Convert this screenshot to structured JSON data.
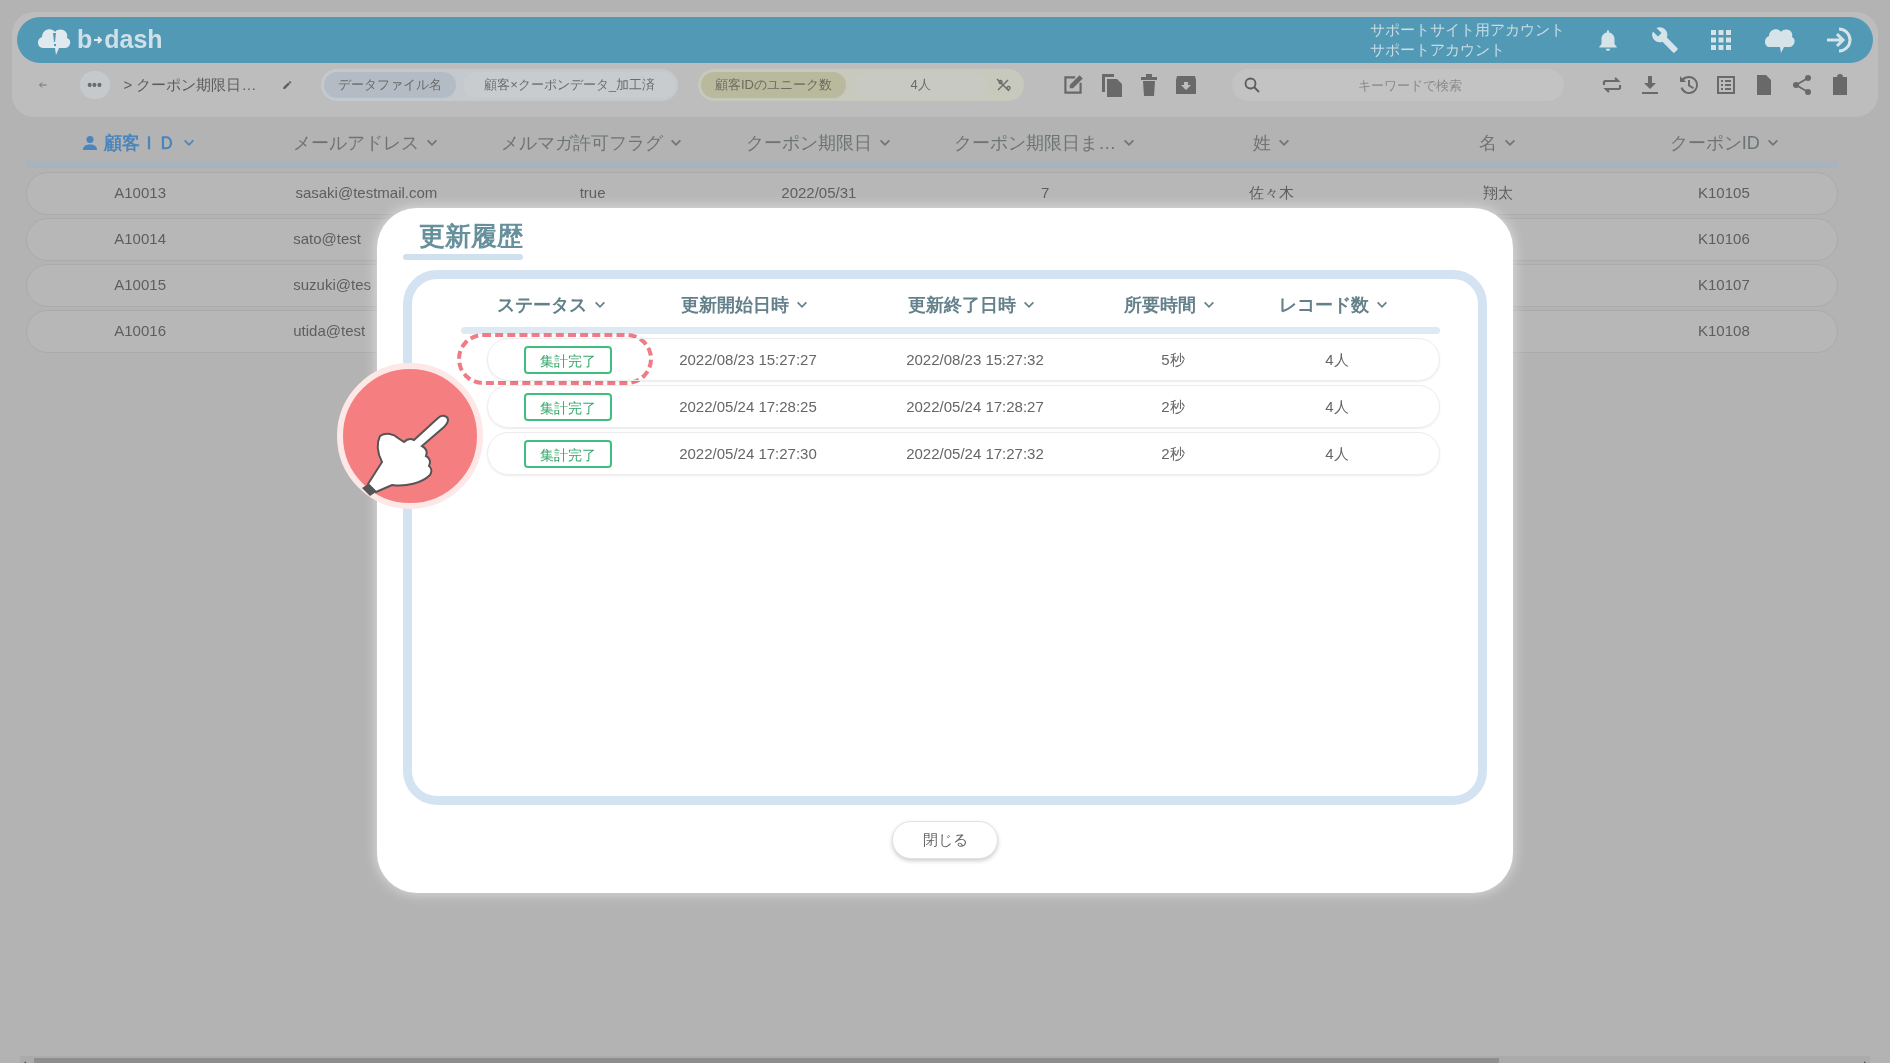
{
  "app": {
    "logo_left": "b",
    "logo_right": "dash",
    "account": [
      "サポートサイト用アカウント",
      "サポートアカウント"
    ]
  },
  "toolbar": {
    "more_label": "•••",
    "breadcrumb": "> クーポン期限日…",
    "file_label": "データファイル名",
    "file_name": "顧客×クーポンデータ_加工済",
    "metric_label": "顧客IDのユニーク数",
    "metric_value": "4人",
    "search_placeholder": "キーワードで検索"
  },
  "columns": [
    {
      "label": "顧客ＩＤ",
      "active": true
    },
    {
      "label": "メールアドレス",
      "active": false
    },
    {
      "label": "メルマガ許可フラグ",
      "active": false
    },
    {
      "label": "クーポン期限日",
      "active": false
    },
    {
      "label": "クーポン期限日ま…",
      "active": false
    },
    {
      "label": "姓",
      "active": false
    },
    {
      "label": "名",
      "active": false
    },
    {
      "label": "クーポンID",
      "active": false
    }
  ],
  "rows": [
    {
      "customer_id": "A10013",
      "email": "sasaki@testmail.com",
      "opt_in": "true",
      "expiry": "2022/05/31",
      "days": "7",
      "last_name": "佐々木",
      "first_name": "翔太",
      "coupon_id": "K10105"
    },
    {
      "customer_id": "A10014",
      "email": "sato@test",
      "coupon_id": "K10106"
    },
    {
      "customer_id": "A10015",
      "email": "suzuki@tes",
      "coupon_id": "K10107"
    },
    {
      "customer_id": "A10016",
      "email": "utida@test",
      "coupon_id": "K10108"
    }
  ],
  "modal": {
    "title": "更新履歴",
    "columns": [
      "ステータス",
      "更新開始日時",
      "更新終了日時",
      "所要時間",
      "レコード数"
    ],
    "rows": [
      {
        "status": "集計完了",
        "start": "2022/08/23 15:27:27",
        "end": "2022/08/23 15:27:32",
        "duration": "5秒",
        "records": "4人",
        "highlighted": true
      },
      {
        "status": "集計完了",
        "start": "2022/05/24 17:28:25",
        "end": "2022/05/24 17:28:27",
        "duration": "2秒",
        "records": "4人",
        "highlighted": false
      },
      {
        "status": "集計完了",
        "start": "2022/05/24 17:27:30",
        "end": "2022/05/24 17:27:32",
        "duration": "2秒",
        "records": "4人",
        "highlighted": false
      }
    ],
    "close_label": "閉じる"
  }
}
